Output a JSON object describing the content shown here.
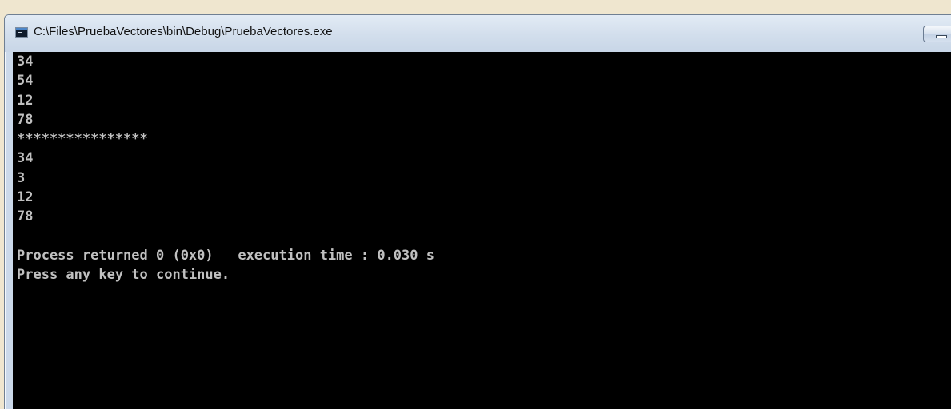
{
  "window": {
    "title": "C:\\Files\\PruebaVectores\\bin\\Debug\\PruebaVectores.exe"
  },
  "console": {
    "lines": [
      "34",
      "54",
      "12",
      "78",
      "****************",
      "34",
      "3",
      "12",
      "78",
      "",
      "Process returned 0 (0x0)   execution time : 0.030 s",
      "Press any key to continue."
    ]
  },
  "colors": {
    "console_background": "#000000",
    "console_text": "#c0c0c0",
    "titlebar": "#d2deec",
    "desktop": "#efe6cf"
  },
  "icons": {
    "app_icon": "console-window-icon",
    "minimize": "minimize-icon"
  }
}
